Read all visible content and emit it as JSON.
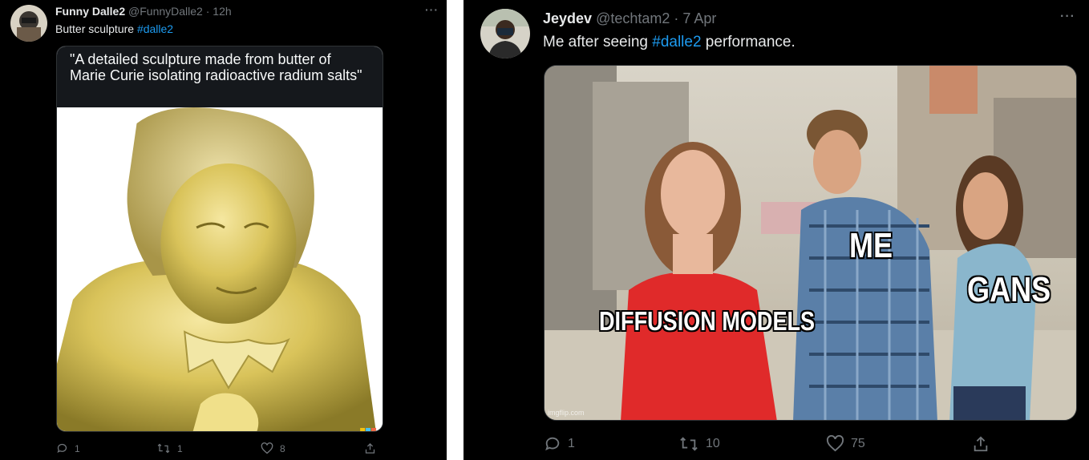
{
  "tweets": [
    {
      "author_name": "Funny Dalle2",
      "handle": "@FunnyDalle2",
      "time": "· 12h",
      "text": "Butter sculpture ",
      "hashtag": "#dalle2",
      "more": "···",
      "media_caption": "\"A detailed sculpture made from butter of Marie Curie isolating radioactive radium salts\"",
      "stats": {
        "replies": "1",
        "retweets": "1",
        "likes": "8"
      }
    },
    {
      "author_name": "Jeydev",
      "handle": "@techtam2",
      "time": "· 7 Apr",
      "text_before": "Me after seeing ",
      "hashtag": "#dalle2",
      "text_after": " performance.",
      "more": "···",
      "meme_labels": {
        "left": "DIFFUSION MODELS",
        "center": "ME",
        "right": "GANS"
      },
      "watermark": "imgflip.com",
      "stats": {
        "replies": "1",
        "retweets": "10",
        "likes": "75"
      }
    }
  ],
  "colors": {
    "background": "#000000",
    "text": "#e7e9ea",
    "muted": "#71767b",
    "hashtag": "#1d9bf0"
  },
  "icons": [
    "reply-icon",
    "retweet-icon",
    "like-icon",
    "share-icon",
    "more-icon"
  ]
}
